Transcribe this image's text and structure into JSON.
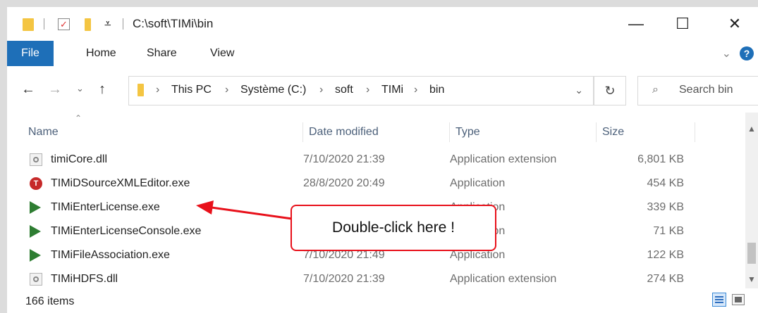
{
  "titlebar": {
    "path": "C:\\soft\\TIMi\\bin",
    "qa_dropdown": "⩡",
    "minimize": "—",
    "maximize": "☐",
    "close": "✕"
  },
  "ribbon": {
    "tabs": [
      "File",
      "Home",
      "Share",
      "View"
    ],
    "help": "?"
  },
  "address": {
    "crumbs": [
      "This PC",
      "Système (C:)",
      "soft",
      "TIMi",
      "bin"
    ],
    "separator": "›",
    "search_placeholder": "Search bin"
  },
  "columns": [
    "Name",
    "Date modified",
    "Type",
    "Size"
  ],
  "rows": [
    {
      "name": "timiCore.dll",
      "date": "7/10/2020 21:39",
      "type": "Application extension",
      "size": "6,801 KB",
      "icon": "dll-file-icon"
    },
    {
      "name": "TIMiDSourceXMLEditor.exe",
      "date": "28/8/2020 20:49",
      "type": "Application",
      "size": "454 KB",
      "icon": "timi-red-icon"
    },
    {
      "name": "TIMiEnterLicense.exe",
      "date": "",
      "type": "Application",
      "size": "339 KB",
      "icon": "timi-app-icon"
    },
    {
      "name": "TIMiEnterLicenseConsole.exe",
      "date": "",
      "type": "Application",
      "size": "71 KB",
      "icon": "timi-app-icon"
    },
    {
      "name": "TIMiFileAssociation.exe",
      "date": "7/10/2020 21:49",
      "type": "Application",
      "size": "122 KB",
      "icon": "timi-app-icon"
    },
    {
      "name": "TIMiHDFS.dll",
      "date": "7/10/2020 21:39",
      "type": "Application extension",
      "size": "274 KB",
      "icon": "dll-file-icon"
    }
  ],
  "status": {
    "item_count": "166 items"
  },
  "annotation": {
    "text": "Double-click here !",
    "color": "#e8101a"
  }
}
